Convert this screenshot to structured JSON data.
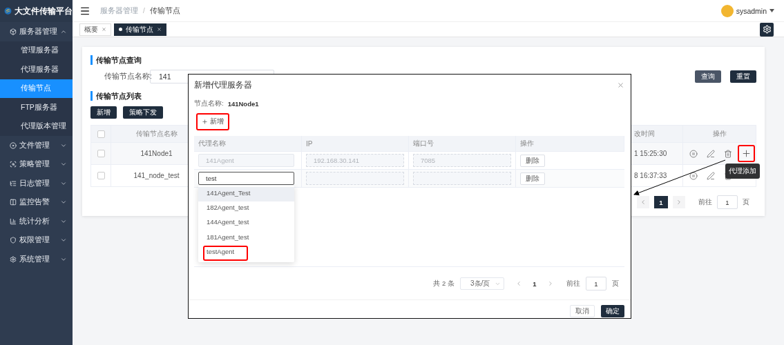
{
  "app": {
    "title": "大文件传输平台"
  },
  "sidebar": {
    "items": [
      {
        "label": "服务器管理",
        "expanded": true,
        "children": [
          {
            "label": "管理服务器",
            "selected": false
          },
          {
            "label": "代理服务器",
            "selected": false
          },
          {
            "label": "传输节点",
            "selected": true
          },
          {
            "label": "FTP服务器",
            "selected": false
          },
          {
            "label": "代理版本管理",
            "selected": false
          }
        ]
      },
      {
        "label": "文件管理",
        "expanded": false
      },
      {
        "label": "策略管理",
        "expanded": false
      },
      {
        "label": "日志管理",
        "expanded": false
      },
      {
        "label": "监控告警",
        "expanded": false
      },
      {
        "label": "统计分析",
        "expanded": false
      },
      {
        "label": "权限管理",
        "expanded": false
      },
      {
        "label": "系统管理",
        "expanded": false
      }
    ]
  },
  "header": {
    "breadcrumb": [
      "服务器管理",
      "传输节点"
    ],
    "separator": "/",
    "user": "sysadmin"
  },
  "tabs": [
    {
      "label": "概要",
      "selected": false
    },
    {
      "label": "传输节点",
      "selected": true
    }
  ],
  "page": {
    "query_title": "传输节点查询",
    "query_label": "传输节点名称:",
    "query_value": "141",
    "search_button": "查询",
    "reset_button": "重置",
    "list_title": "传输节点列表",
    "actions": [
      "新增",
      "策略下发"
    ],
    "table": {
      "all_checked": false,
      "columns": [
        "传输节点名称",
        "改时间",
        "操作"
      ],
      "rows": [
        {
          "checked": false,
          "name": "141Node1",
          "time": "1 15:25:30",
          "actions": [
            {
              "kind": "pause"
            },
            {
              "kind": "edit"
            },
            {
              "kind": "delete"
            },
            {
              "kind": "add",
              "highlighted": true
            }
          ]
        },
        {
          "checked": false,
          "name": "141_node_test",
          "time": "8 16:37:33",
          "actions": [
            {
              "kind": "pause"
            },
            {
              "kind": "edit"
            },
            {
              "kind": "delete"
            }
          ]
        }
      ]
    },
    "tooltip": "代理添加",
    "pagination": {
      "page": "1",
      "goto_label": "前往",
      "goto_value": "1",
      "page_unit": "页"
    }
  },
  "dialog": {
    "title": "新增代理服务器",
    "node_label": "节点名称:",
    "node_value": "141Node1",
    "add_button": {
      "label": "新增",
      "highlighted": true
    },
    "columns": [
      "代理名称",
      "IP",
      "端口号",
      "操作"
    ],
    "rows": [
      {
        "name": "141Agent",
        "ip": "192.168.30.141",
        "port": "7085",
        "disabled": true,
        "focused": false,
        "delete": "删除"
      },
      {
        "name": "test",
        "disabled": false,
        "focused": true,
        "delete": "删除"
      }
    ],
    "options": [
      {
        "label": "141Agent_Test",
        "hovered": true,
        "highlighted": false
      },
      {
        "label": "182Agent_test",
        "hovered": false,
        "highlighted": false
      },
      {
        "label": "144Agent_test",
        "hovered": false,
        "highlighted": false
      },
      {
        "label": "181Agent_test",
        "hovered": false,
        "highlighted": false
      },
      {
        "label": "testAgent",
        "hovered": false,
        "highlighted": true
      }
    ],
    "pagination": {
      "total": "共 2 条",
      "page_size": "3条/页",
      "page": "1",
      "goto_label": "前往",
      "goto_value": "1",
      "page_unit": "页"
    },
    "cancel_button": "取消",
    "confirm_button": "确定"
  }
}
